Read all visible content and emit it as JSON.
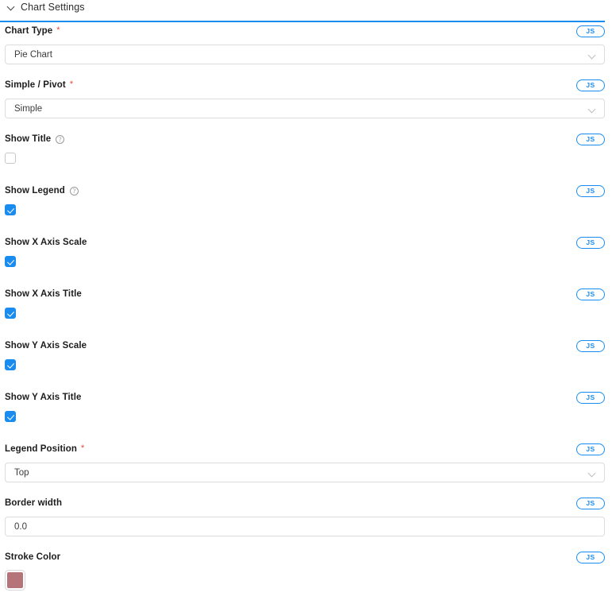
{
  "panel": {
    "title": "Chart Settings",
    "collapse_icon": "chevron-down-icon",
    "accent_color": "#1a8cf0"
  },
  "badge": {
    "label": "JS"
  },
  "icons": {
    "help": "?",
    "chevron_down": "chevron-down-icon"
  },
  "colors": {
    "accent": "#1a8cf0",
    "required_star": "#e8453c",
    "stroke_color_swatch": "#b5737a",
    "border": "#dcdcdc",
    "checkbox_checked": "#1a8cf0"
  },
  "fields": [
    {
      "label": "Chart Type",
      "required": true,
      "help": false,
      "control": "select",
      "value": "Pie Chart",
      "badge": "JS"
    },
    {
      "label": "Simple / Pivot",
      "required": true,
      "help": false,
      "control": "select",
      "value": "Simple",
      "badge": "JS"
    },
    {
      "label": "Show Title",
      "required": false,
      "help": true,
      "control": "checkbox",
      "checked": false,
      "badge": "JS"
    },
    {
      "label": "Show Legend",
      "required": false,
      "help": true,
      "control": "checkbox",
      "checked": true,
      "badge": "JS"
    },
    {
      "label": "Show X Axis Scale",
      "required": false,
      "help": false,
      "control": "checkbox",
      "checked": true,
      "badge": "JS"
    },
    {
      "label": "Show X Axis Title",
      "required": false,
      "help": false,
      "control": "checkbox",
      "checked": true,
      "badge": "JS"
    },
    {
      "label": "Show Y Axis Scale",
      "required": false,
      "help": false,
      "control": "checkbox",
      "checked": true,
      "badge": "JS"
    },
    {
      "label": "Show Y Axis Title",
      "required": false,
      "help": false,
      "control": "checkbox",
      "checked": true,
      "badge": "JS"
    },
    {
      "label": "Legend Position",
      "required": true,
      "help": false,
      "control": "select",
      "value": "Top",
      "badge": "JS"
    },
    {
      "label": "Border width",
      "required": false,
      "help": false,
      "control": "text",
      "value": "0.0",
      "badge": "JS"
    },
    {
      "label": "Stroke Color",
      "required": false,
      "help": false,
      "control": "color",
      "value": "#b5737a",
      "badge": "JS"
    }
  ]
}
